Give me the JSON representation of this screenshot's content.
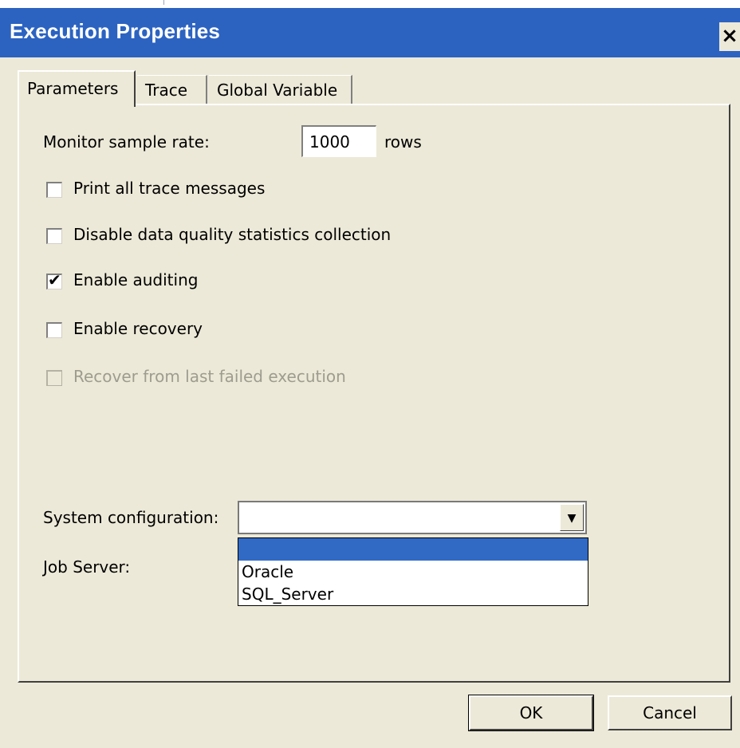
{
  "window": {
    "title": "Execution Properties",
    "close_glyph": "×"
  },
  "tabs": [
    {
      "label": "Parameters",
      "active": true
    },
    {
      "label": "Trace",
      "active": false
    },
    {
      "label": "Global Variable",
      "active": false
    }
  ],
  "parameters": {
    "monitor_label": "Monitor sample rate:",
    "monitor_value": "1000",
    "monitor_unit": "rows",
    "checkboxes": [
      {
        "label": "Print all trace messages",
        "checked": false,
        "enabled": true
      },
      {
        "label": "Disable data quality statistics collection",
        "checked": false,
        "enabled": true
      },
      {
        "label": "Enable auditing",
        "checked": true,
        "enabled": true
      },
      {
        "label": "Enable recovery",
        "checked": false,
        "enabled": true
      },
      {
        "label": "Recover from last failed execution",
        "checked": false,
        "enabled": false
      }
    ],
    "system_config_label": "System configuration:",
    "system_config_value": "",
    "system_config_options": [
      "",
      "Oracle",
      "SQL_Server"
    ],
    "job_server_label": "Job Server:"
  },
  "buttons": {
    "ok": "OK",
    "cancel": "Cancel"
  },
  "colors": {
    "titlebar": "#2c63c1",
    "dialog_bg": "#ece9d8",
    "selection": "#316ac5"
  }
}
